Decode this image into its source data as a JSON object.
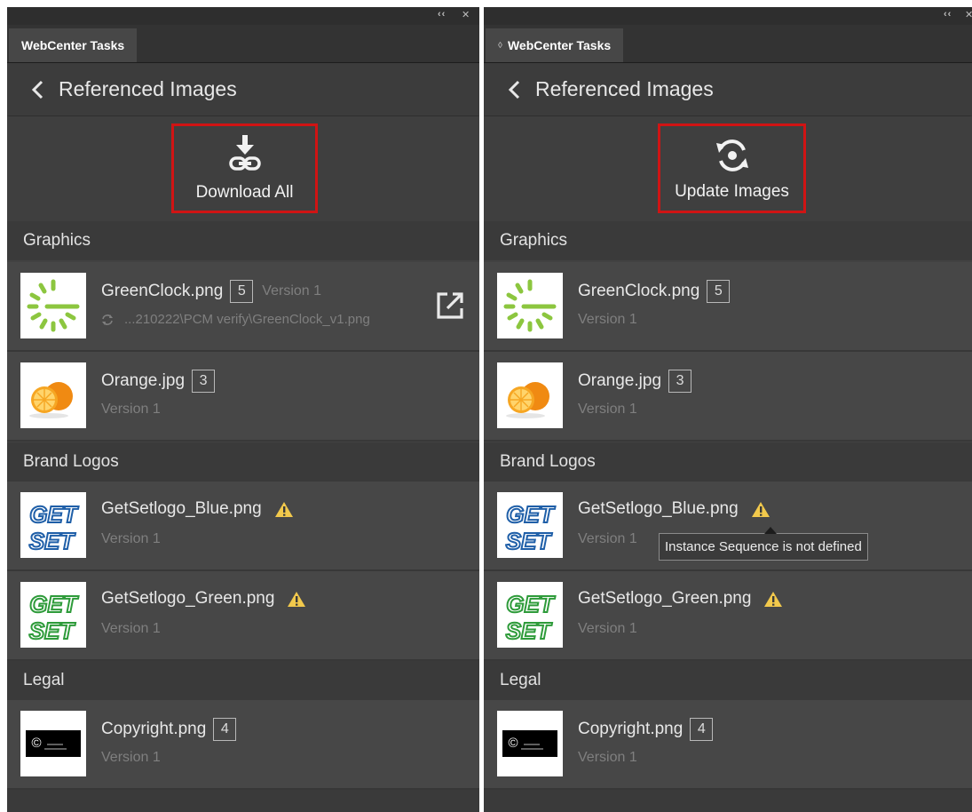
{
  "panels": [
    {
      "tab": "WebCenter Tasks",
      "title": "Referenced Images",
      "action": "Download All",
      "sections": [
        {
          "name": "Graphics"
        },
        {
          "name": "Brand Logos"
        },
        {
          "name": "Legal"
        }
      ],
      "items": [
        {
          "file": "GreenClock.png",
          "count": "5",
          "version": "Version 1",
          "path": "...210222\\PCM verify\\GreenClock_v1.png"
        },
        {
          "file": "Orange.jpg",
          "count": "3",
          "version": "Version 1"
        },
        {
          "file": "GetSetlogo_Blue.png",
          "version": "Version 1"
        },
        {
          "file": "GetSetlogo_Green.png",
          "version": "Version 1"
        },
        {
          "file": "Copyright.png",
          "count": "4",
          "version": "Version 1"
        }
      ]
    },
    {
      "tab": "WebCenter Tasks",
      "title": "Referenced Images",
      "action": "Update Images",
      "sections": [
        {
          "name": "Graphics"
        },
        {
          "name": "Brand Logos"
        },
        {
          "name": "Legal"
        }
      ],
      "items": [
        {
          "file": "GreenClock.png",
          "count": "5",
          "version": "Version 1"
        },
        {
          "file": "Orange.jpg",
          "count": "3",
          "version": "Version 1"
        },
        {
          "file": "GetSetlogo_Blue.png",
          "version": "Version 1"
        },
        {
          "file": "GetSetlogo_Green.png",
          "version": "Version 1"
        },
        {
          "file": "Copyright.png",
          "count": "4",
          "version": "Version 1"
        }
      ],
      "tooltip": "Instance Sequence is not defined"
    }
  ],
  "thumbnails": {
    "getset_text_top": "GET",
    "getset_text_bottom": "SET",
    "copyright_symbol": "©"
  },
  "colors": {
    "highlight": "#d01414",
    "warning": "#f2c94c",
    "logo_blue": "#1f5fa8",
    "logo_green": "#2e9b3a",
    "clock_green": "#8cc63f"
  }
}
